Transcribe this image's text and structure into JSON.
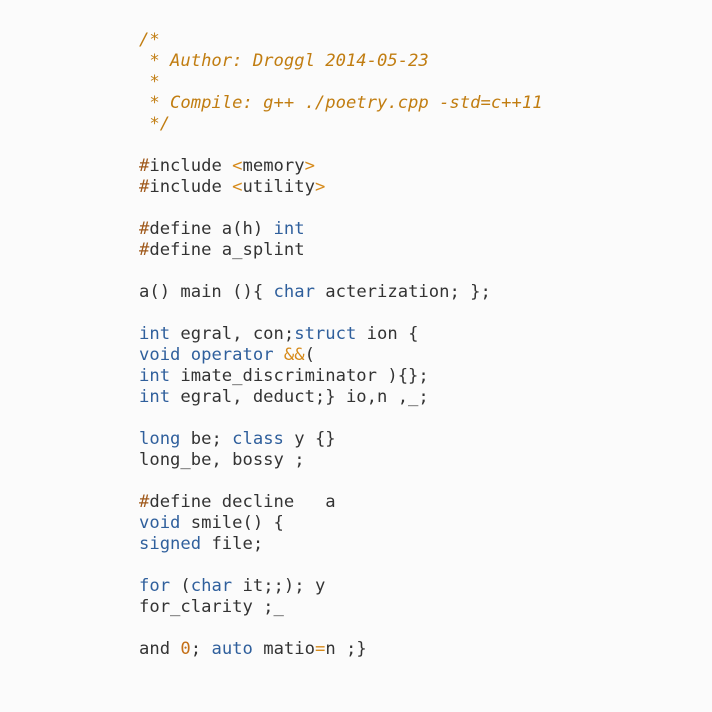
{
  "colors": {
    "background": "#fbfbfb",
    "default_text": "#333333",
    "comment": "#c17d11",
    "preprocessor": "#a05a1c",
    "header": "#c46f16",
    "keyword": "#2f5f9c",
    "operator": "#d68a1a",
    "number": "#c46f16"
  },
  "code": {
    "lines": [
      [
        {
          "t": "/*",
          "k": "c"
        }
      ],
      [
        {
          "t": " * Author: Droggl 2014-05-23",
          "k": "c"
        }
      ],
      [
        {
          "t": " *",
          "k": "c"
        }
      ],
      [
        {
          "t": " * Compile: g++ ./poetry.cpp -std=c++11",
          "k": "c"
        }
      ],
      [
        {
          "t": " */",
          "k": "c"
        }
      ],
      [],
      [
        {
          "t": "#",
          "k": "pp"
        },
        {
          "t": "include ",
          "k": "tx"
        },
        {
          "t": "<",
          "k": "op"
        },
        {
          "t": "memory",
          "k": "tx"
        },
        {
          "t": ">",
          "k": "op"
        }
      ],
      [
        {
          "t": "#",
          "k": "pp"
        },
        {
          "t": "include ",
          "k": "tx"
        },
        {
          "t": "<",
          "k": "op"
        },
        {
          "t": "utility",
          "k": "tx"
        },
        {
          "t": ">",
          "k": "op"
        }
      ],
      [],
      [
        {
          "t": "#",
          "k": "pp"
        },
        {
          "t": "define a(h) ",
          "k": "tx"
        },
        {
          "t": "int",
          "k": "kw"
        }
      ],
      [
        {
          "t": "#",
          "k": "pp"
        },
        {
          "t": "define a_splint",
          "k": "tx"
        }
      ],
      [],
      [
        {
          "t": "a() main (){ ",
          "k": "tx"
        },
        {
          "t": "char",
          "k": "kw"
        },
        {
          "t": " acterization; };",
          "k": "tx"
        }
      ],
      [],
      [
        {
          "t": "int",
          "k": "kw"
        },
        {
          "t": " egral, con;",
          "k": "tx"
        },
        {
          "t": "struct",
          "k": "kw"
        },
        {
          "t": " ion {",
          "k": "tx"
        }
      ],
      [
        {
          "t": "void",
          "k": "kw"
        },
        {
          "t": " ",
          "k": "tx"
        },
        {
          "t": "operator",
          "k": "kw"
        },
        {
          "t": " ",
          "k": "tx"
        },
        {
          "t": "&&",
          "k": "op"
        },
        {
          "t": "(",
          "k": "tx"
        }
      ],
      [
        {
          "t": "int",
          "k": "kw"
        },
        {
          "t": " imate_discriminator ){};",
          "k": "tx"
        }
      ],
      [
        {
          "t": "int",
          "k": "kw"
        },
        {
          "t": " egral, deduct;} io,n ,_;",
          "k": "tx"
        }
      ],
      [],
      [
        {
          "t": "long",
          "k": "kw"
        },
        {
          "t": " be; ",
          "k": "tx"
        },
        {
          "t": "class",
          "k": "kw"
        },
        {
          "t": " y {}",
          "k": "tx"
        }
      ],
      [
        {
          "t": "long_be, bossy ;",
          "k": "tx"
        }
      ],
      [],
      [
        {
          "t": "#",
          "k": "pp"
        },
        {
          "t": "define decline   a",
          "k": "tx"
        }
      ],
      [
        {
          "t": "void",
          "k": "kw"
        },
        {
          "t": " smile() {",
          "k": "tx"
        }
      ],
      [
        {
          "t": "signed",
          "k": "kw"
        },
        {
          "t": " file;",
          "k": "tx"
        }
      ],
      [],
      [
        {
          "t": "for",
          "k": "kw"
        },
        {
          "t": " (",
          "k": "tx"
        },
        {
          "t": "char",
          "k": "kw"
        },
        {
          "t": " it;;); y",
          "k": "tx"
        }
      ],
      [
        {
          "t": "for_clarity ;_",
          "k": "tx"
        }
      ],
      [],
      [
        {
          "t": "and ",
          "k": "tx"
        },
        {
          "t": "0",
          "k": "num"
        },
        {
          "t": "; ",
          "k": "tx"
        },
        {
          "t": "auto",
          "k": "kw"
        },
        {
          "t": " matio",
          "k": "tx"
        },
        {
          "t": "=",
          "k": "op"
        },
        {
          "t": "n ;}",
          "k": "tx"
        }
      ]
    ]
  }
}
